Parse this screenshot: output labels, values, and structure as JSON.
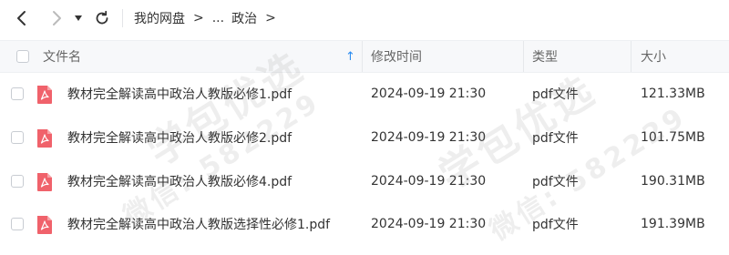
{
  "breadcrumb": {
    "root": "我的网盘",
    "sep": ">",
    "ellipsis": "...",
    "current": "政治"
  },
  "table": {
    "headers": {
      "name": "文件名",
      "modified": "修改时间",
      "type": "类型",
      "size": "大小"
    },
    "sort_indicator": "↑",
    "rows": [
      {
        "name": "教材完全解读高中政治人教版必修1.pdf",
        "modified": "2024-09-19 21:30",
        "type": "pdf文件",
        "size": "121.33MB"
      },
      {
        "name": "教材完全解读高中政治人教版必修2.pdf",
        "modified": "2024-09-19 21:30",
        "type": "pdf文件",
        "size": "101.75MB"
      },
      {
        "name": "教材完全解读高中政治人教版必修4.pdf",
        "modified": "2024-09-19 21:30",
        "type": "pdf文件",
        "size": "190.31MB"
      },
      {
        "name": "教材完全解读高中政治人教版选择性必修1.pdf",
        "modified": "2024-09-19 21:30",
        "type": "pdf文件",
        "size": "191.39MB"
      }
    ]
  },
  "watermark": {
    "brand": "学包优选",
    "contact": "微信: 582229"
  },
  "colors": {
    "accent": "#2a8cf0",
    "pdf_icon": "#f0626b",
    "header_bg": "#f7f8fa"
  }
}
